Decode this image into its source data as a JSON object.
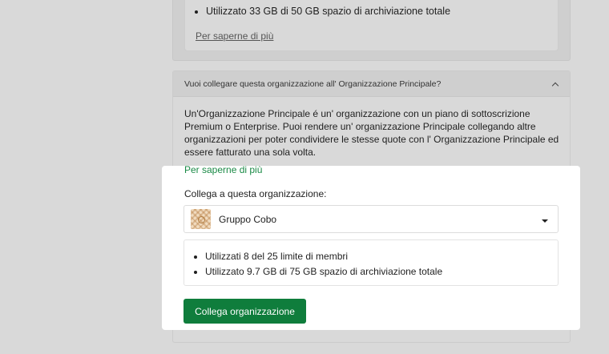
{
  "top_section": {
    "usage_items": [
      "Utilizzato 33 GB di 50 GB spazio di archiviazione totale"
    ],
    "learn_more": "Per saperne di più"
  },
  "accordion": {
    "title": "Vuoi collegare questa organizzazione all' Organizzazione Principale?",
    "description": "Un'Organizzazione Principale é un' organizzazione con un piano di sottoscrizione Premium o Enterprise. Puoi rendere un' organizzazione Principale collegando altre organizzazioni per poter condividere le stesse quote con l' Organizzazione Principale ed essere fatturato una sola volta.",
    "learn_more": "Per saperne di più"
  },
  "link_form": {
    "label": "Collega a questa organizzazione:",
    "selected_org": "Gruppo Cobo",
    "usage_items": [
      "Utilizzati 8 del 25 limite di membri",
      "Utilizzato 9.7 GB di 75 GB spazio di archiviazione totale"
    ],
    "button_label": "Collega organizzazione",
    "button_color": "#0f7d3c",
    "link_color": "#1a8a46"
  }
}
